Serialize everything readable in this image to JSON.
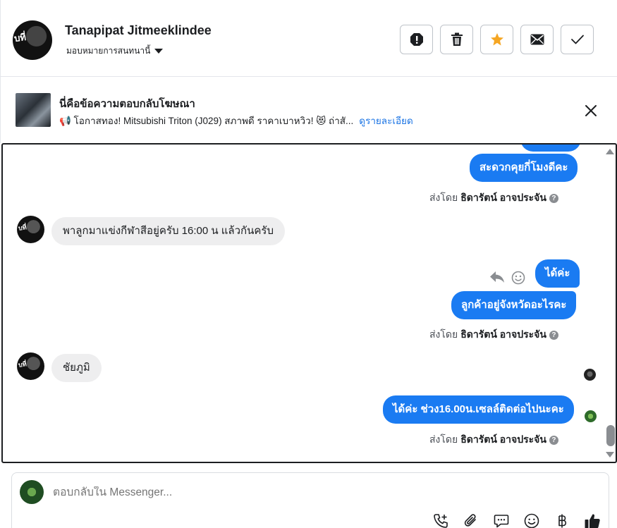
{
  "header": {
    "avatar_text": "บที่",
    "name": "Tanapipat Jitmeeklindee",
    "assign_label": "มอบหมายการสนทนานี้"
  },
  "ad": {
    "title": "นี่คือข้อความตอบกลับโฆษณา",
    "description": "📢 โอกาสทอง! Mitsubishi Triton (J029) สภาพดี ราคาเบาหวิว! 😻 ถ่าสั...",
    "details_link": "ดูรายละเอียด"
  },
  "messages": {
    "m1": "สะดวกคุยกี่โมงดีคะ",
    "sent1_prefix": "ส่งโดย",
    "sent1_name": "ธิดารัตน์ อาจประจัน",
    "m2": "พาลูกมาแข่งกีฬาสีอยู่ครับ 16:00 น แล้วกันครับ",
    "m3": "ได้ค่ะ",
    "m4": "ลูกค้าอยู่จังหวัดอะไรคะ",
    "sent2_prefix": "ส่งโดย",
    "sent2_name": "ธิดารัตน์ อาจประจัน",
    "m5": "ชัยภูมิ",
    "m6": "ได้ค่ะ ช่วง16.00น.เซลล์ติดต่อไปนะคะ",
    "sent3_prefix": "ส่งโดย",
    "sent3_name": "ธิดารัตน์ อาจประจัน",
    "help_glyph": "?"
  },
  "composer": {
    "placeholder": "ตอบกลับใน Messenger..."
  },
  "icons": {
    "accent": "#1a7bf2",
    "star_color": "#f5a623"
  }
}
